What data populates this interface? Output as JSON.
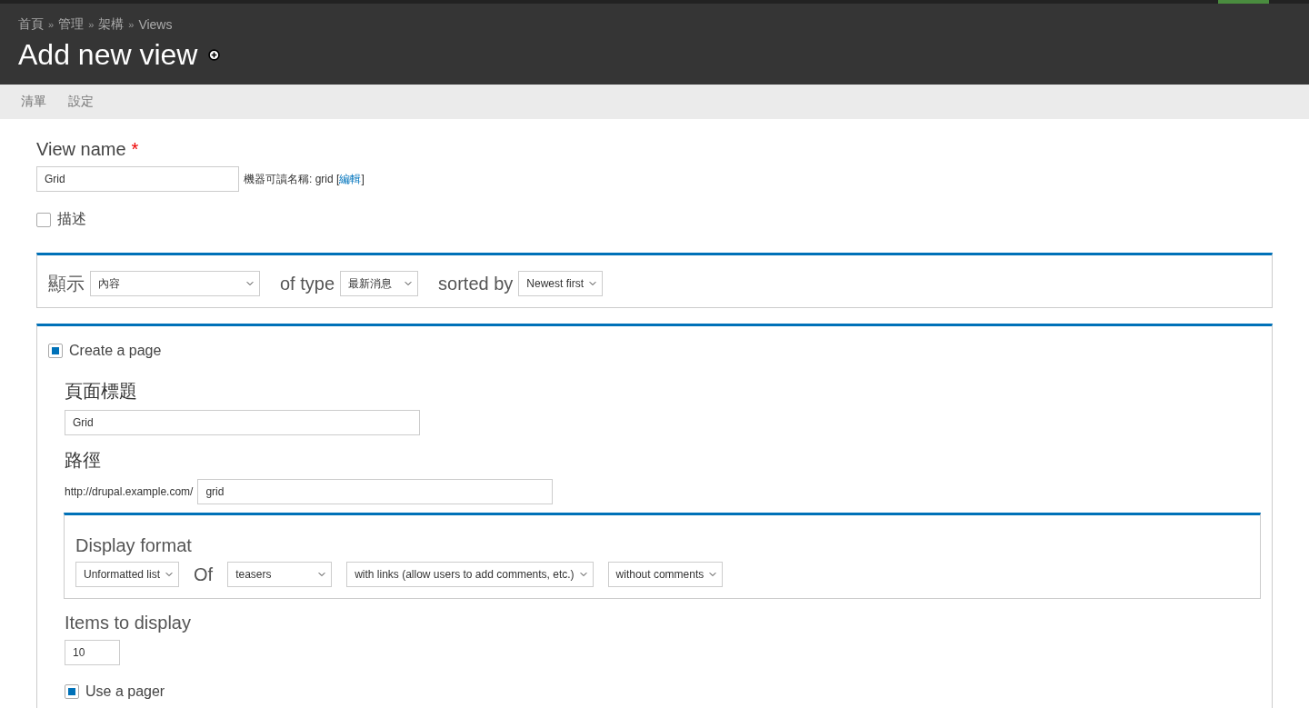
{
  "breadcrumb": [
    "首頁",
    "管理",
    "架構",
    "Views"
  ],
  "breadcrumb_separator": "»",
  "title": "Add new view",
  "tabs": [
    {
      "label": "清單",
      "selected": false
    },
    {
      "label": "設定",
      "selected": false
    }
  ],
  "view_name": {
    "label": "View name",
    "required_mark": "*",
    "value": "Grid",
    "machine_name": "機器可讀名稱: grid",
    "open": "[",
    "edit_link": "編輯",
    "close": "]"
  },
  "description": {
    "label": "描述",
    "checked": false
  },
  "show": [
    {
      "label": "顯示",
      "value": "內容"
    },
    {
      "label": "of type",
      "value": "最新消息"
    },
    {
      "label": "sorted by",
      "value": "Newest first"
    }
  ],
  "page": {
    "create": {
      "label": "Create a page",
      "checked": true
    },
    "page_title": {
      "label": "頁面標題",
      "value": "Grid"
    },
    "path": {
      "label": "路徑",
      "prefix": "http://drupal.example.com/",
      "value": "grid"
    },
    "display_format": {
      "label": "Display format",
      "items": [
        {
          "kind": "select",
          "value": "Unformatted list"
        },
        {
          "kind": "text",
          "value": "Of"
        },
        {
          "kind": "select",
          "value": "teasers"
        },
        {
          "kind": "select",
          "value": "with links (allow users to add comments, etc.)"
        },
        {
          "kind": "select",
          "value": "without comments"
        }
      ]
    },
    "items_to_display": {
      "label": "Items to display",
      "value": "10"
    },
    "pager": {
      "label": "Use a pager",
      "checked": true
    }
  }
}
